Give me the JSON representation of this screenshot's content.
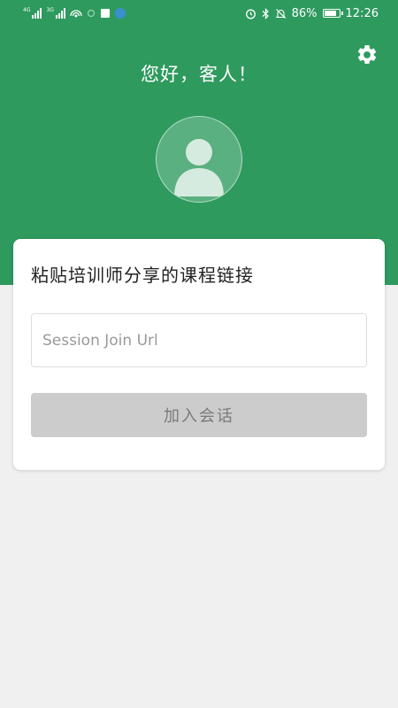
{
  "status_bar": {
    "signal1_label": "4G",
    "signal2_label": "3G",
    "battery_text": "86%",
    "battery_level": 0.86,
    "time": "12:26"
  },
  "header": {
    "greeting": "您好，客人！",
    "settings_icon": "gear-icon",
    "avatar_icon": "user-avatar-icon"
  },
  "card": {
    "title": "粘贴培训师分享的课程链接",
    "url_input": {
      "placeholder": "Session Join Url",
      "value": ""
    },
    "join_button_label": "加入会话"
  },
  "colors": {
    "primary_green": "#2e9a5e",
    "background": "#f0f0f0",
    "disabled_button": "#cccccc"
  }
}
